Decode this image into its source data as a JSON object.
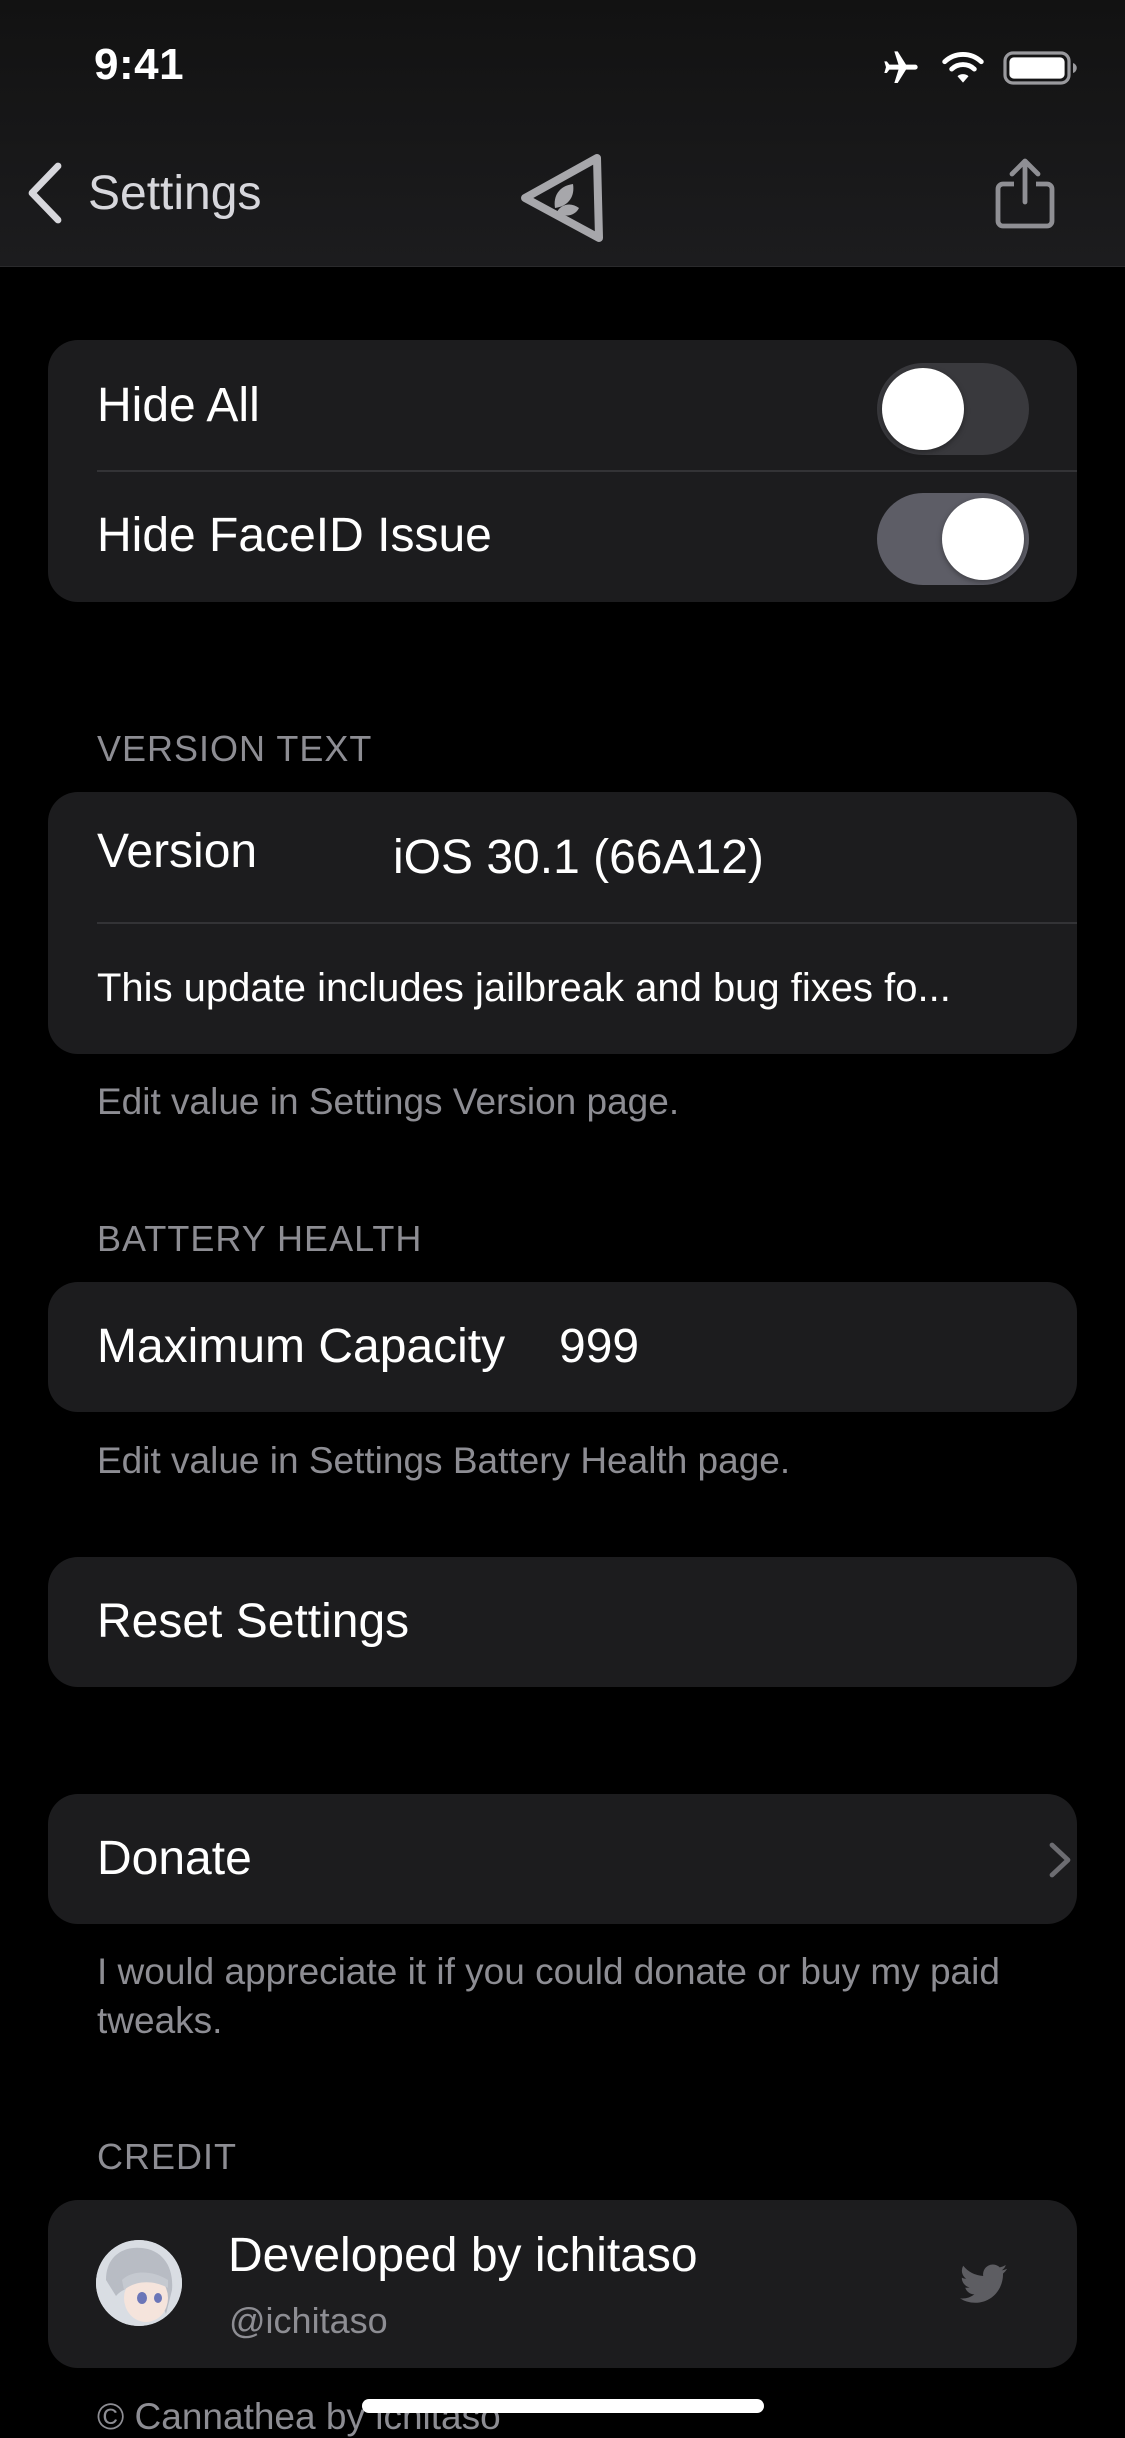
{
  "status_bar": {
    "time": "9:41"
  },
  "nav": {
    "back_label": "Settings"
  },
  "toggles": [
    {
      "label": "Hide All",
      "on": false
    },
    {
      "label": "Hide FaceID Issue",
      "on": true
    }
  ],
  "version_section": {
    "header": "VERSION TEXT",
    "version_label": "Version",
    "version_value": "iOS 30.1 (66A12)",
    "description": "This update includes jailbreak and bug fixes fo...",
    "footer": "Edit value in Settings Version page."
  },
  "battery_section": {
    "header": "BATTERY HEALTH",
    "label": "Maximum Capacity",
    "value": "999",
    "footer": "Edit value in Settings Battery Health page."
  },
  "reset": {
    "label": "Reset Settings"
  },
  "donate": {
    "label": "Donate",
    "footer": "I would appreciate it if you could donate or buy my paid tweaks."
  },
  "credit": {
    "header": "CREDIT",
    "name": "Developed by ichitaso",
    "handle": "@ichitaso",
    "copyright": "© Cannathea by ichitaso"
  },
  "icons": [
    "airplane-icon",
    "wifi-icon",
    "battery-icon",
    "chevron-left-icon",
    "app-logo-icon",
    "share-icon",
    "chevron-right-icon",
    "twitter-icon"
  ]
}
